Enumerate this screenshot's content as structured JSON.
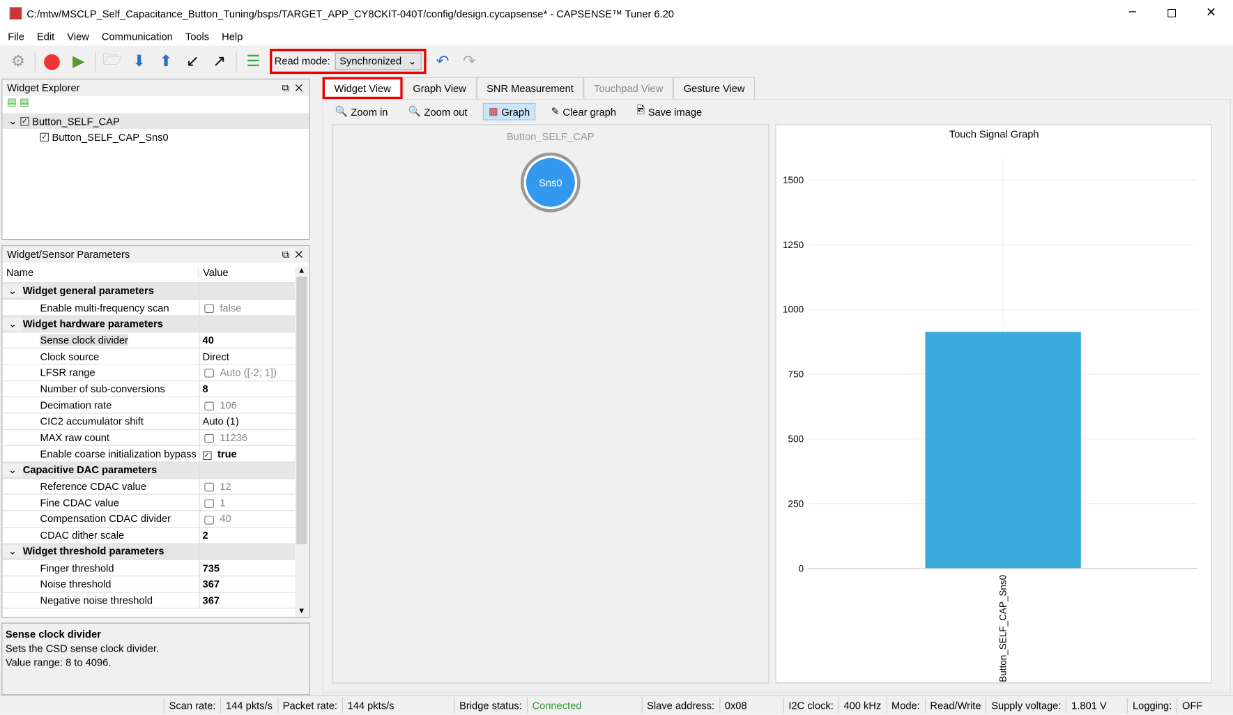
{
  "window": {
    "title": "C:/mtw/MSCLP_Self_Capacitance_Button_Tuning/bsps/TARGET_APP_CY8CKIT-040T/config/design.cycapsense* - CAPSENSE™ Tuner 6.20"
  },
  "menu": [
    "File",
    "Edit",
    "View",
    "Communication",
    "Tools",
    "Help"
  ],
  "toolbar": {
    "read_mode_label": "Read mode:",
    "read_mode_value": "Synchronized"
  },
  "widget_explorer": {
    "title": "Widget Explorer",
    "widget": "Button_SELF_CAP",
    "sensor": "Button_SELF_CAP_Sns0"
  },
  "params": {
    "title": "Widget/Sensor Parameters",
    "col_name": "Name",
    "col_value": "Value",
    "rows": [
      {
        "g": true,
        "name": "Widget general parameters"
      },
      {
        "name": "Enable multi-frequency scan",
        "value": "false",
        "lock": true
      },
      {
        "g": true,
        "name": "Widget hardware parameters"
      },
      {
        "name": "Sense clock divider",
        "value": "40",
        "bold": true,
        "sel": true
      },
      {
        "name": "Clock source",
        "value": "Direct"
      },
      {
        "name": "LFSR range",
        "value": "Auto ([-2; 1])",
        "lock": true
      },
      {
        "name": "Number of sub-conversions",
        "value": "8",
        "bold": true
      },
      {
        "name": "Decimation rate",
        "value": "106",
        "lock": true
      },
      {
        "name": "CIC2 accumulator shift",
        "value": "Auto (1)"
      },
      {
        "name": "MAX raw count",
        "value": "11236",
        "lock": true
      },
      {
        "name": "Enable coarse initialization bypass",
        "value": "true",
        "bold": true,
        "check": true
      },
      {
        "g": true,
        "name": "Capacitive DAC parameters"
      },
      {
        "name": "Reference CDAC value",
        "value": "12",
        "lock": true
      },
      {
        "name": "Fine CDAC value",
        "value": "1",
        "lock": true
      },
      {
        "name": "Compensation CDAC divider",
        "value": "40",
        "lock": true
      },
      {
        "name": "CDAC dither scale",
        "value": "2",
        "bold": true
      },
      {
        "g": true,
        "name": "Widget threshold parameters"
      },
      {
        "name": "Finger threshold",
        "value": "735",
        "bold": true
      },
      {
        "name": "Noise threshold",
        "value": "367",
        "bold": true
      },
      {
        "name": "Negative noise threshold",
        "value": "367",
        "bold": true
      }
    ]
  },
  "description": {
    "title": "Sense clock divider",
    "line1": "Sets the CSD sense clock divider.",
    "line2": "Value range: 8 to 4096."
  },
  "tabs": [
    "Widget View",
    "Graph View",
    "SNR Measurement",
    "Touchpad View",
    "Gesture View"
  ],
  "subtoolbar": {
    "zoom_in": "Zoom in",
    "zoom_out": "Zoom out",
    "graph": "Graph",
    "clear": "Clear graph",
    "save": "Save image"
  },
  "widget_view": {
    "widget_name": "Button_SELF_CAP",
    "sensor_label": "Sns0",
    "accent": "#3399ee"
  },
  "chart_data": {
    "type": "bar",
    "title": "Touch Signal Graph",
    "categories": [
      "Button_SELF_CAP_Sns0"
    ],
    "values": [
      914
    ],
    "ylim": [
      0,
      1585
    ],
    "yticks": [
      0,
      250,
      500,
      750,
      1000,
      1250,
      1500
    ],
    "color": "#3aabdb",
    "grid": true
  },
  "status": [
    [
      "Scan rate:",
      "144 pkts/s"
    ],
    [
      "Packet rate:",
      "144 pkts/s"
    ],
    [
      "Bridge status:",
      "Connected"
    ],
    [
      "Slave address:",
      "0x08"
    ],
    [
      "I2C clock:",
      "400 kHz"
    ],
    [
      "Mode:",
      "Read/Write"
    ],
    [
      "Supply voltage:",
      "1.801 V"
    ],
    [
      "Logging:",
      "OFF"
    ]
  ]
}
